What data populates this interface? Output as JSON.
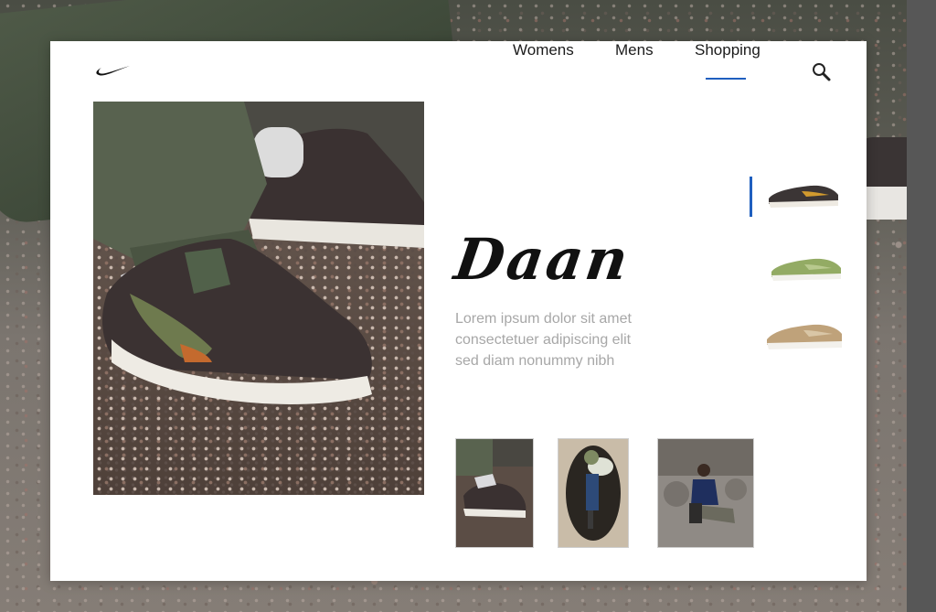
{
  "nav": {
    "items": [
      {
        "label": "Womens",
        "active": false
      },
      {
        "label": "Mens",
        "active": false
      },
      {
        "label": "Shopping",
        "active": true
      }
    ],
    "search_icon": "search-icon"
  },
  "logo": {
    "icon": "swoosh-logo"
  },
  "hero": {
    "title": "Daan",
    "description": [
      "Lorem ipsum dolor sit amet",
      "consectetuer adipiscing elit",
      "sed diam nonummy nibh"
    ]
  },
  "products": [
    {
      "color": "#3b3535",
      "accent": "#d19a2e",
      "selected": true
    },
    {
      "color": "#93ab64",
      "accent": "#b8c98e",
      "selected": false
    },
    {
      "color": "#bfa27a",
      "accent": "#d9c6a6",
      "selected": false
    }
  ],
  "thumbnails": [
    {
      "subject": "shoe-closeup"
    },
    {
      "subject": "person-in-tunnel"
    },
    {
      "subject": "person-sitting-on-rocks"
    }
  ],
  "colors": {
    "accent": "#1f5fbf",
    "text_muted": "#a7a7a7"
  }
}
